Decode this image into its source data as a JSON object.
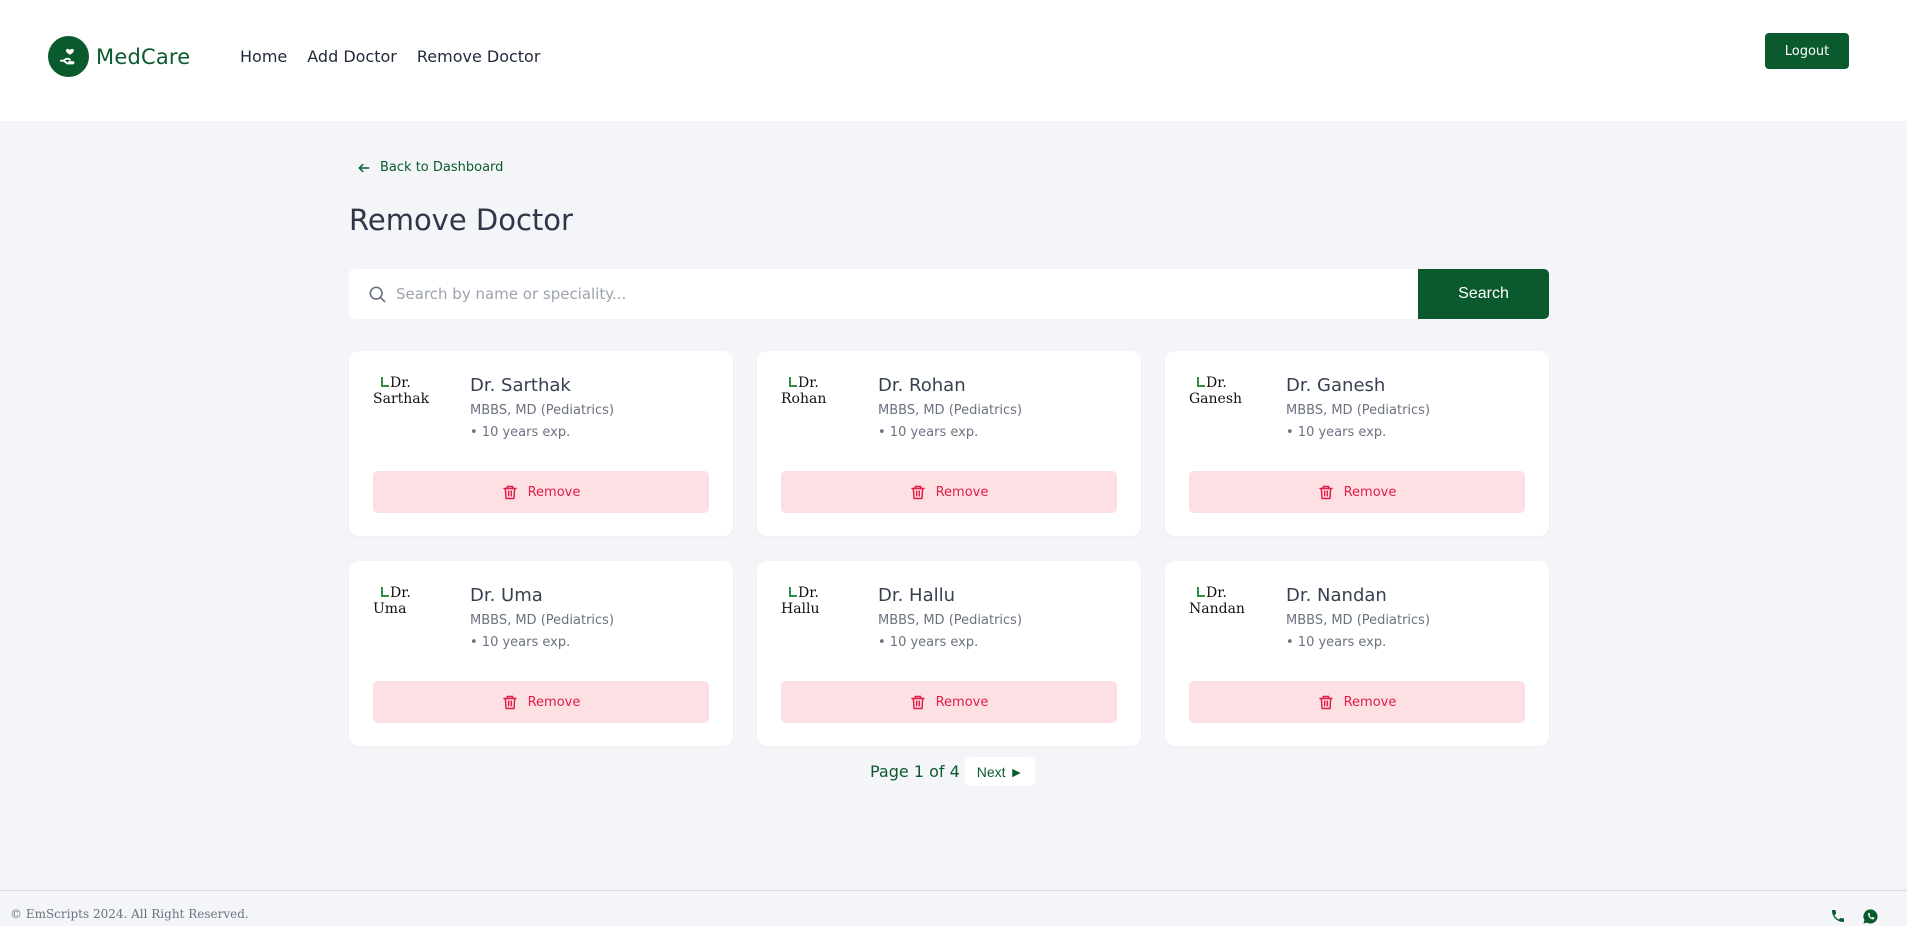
{
  "header": {
    "brand": "MedCare",
    "nav": [
      "Home",
      "Add Doctor",
      "Remove Doctor"
    ],
    "logout": "Logout"
  },
  "page": {
    "back_label": "Back to Dashboard",
    "title": "Remove Doctor"
  },
  "search": {
    "placeholder": "Search by name or speciality...",
    "value": "",
    "button": "Search"
  },
  "doctors": [
    {
      "alt_line1": "Dr.",
      "alt_line2": "Sarthak",
      "name": "Dr. Sarthak",
      "spec": "MBBS, MD (Pediatrics)",
      "exp": "• 10 years exp.",
      "remove": "Remove"
    },
    {
      "alt_line1": "Dr.",
      "alt_line2": "Rohan",
      "name": "Dr. Rohan",
      "spec": "MBBS, MD (Pediatrics)",
      "exp": "• 10 years exp.",
      "remove": "Remove"
    },
    {
      "alt_line1": "Dr.",
      "alt_line2": "Ganesh",
      "name": "Dr. Ganesh",
      "spec": "MBBS, MD (Pediatrics)",
      "exp": "• 10 years exp.",
      "remove": "Remove"
    },
    {
      "alt_line1": "Dr. Uma",
      "alt_line2": "",
      "name": "Dr. Uma",
      "spec": "MBBS, MD (Pediatrics)",
      "exp": "• 10 years exp.",
      "remove": "Remove"
    },
    {
      "alt_line1": "Dr. Hallu",
      "alt_line2": "",
      "name": "Dr. Hallu",
      "spec": "MBBS, MD (Pediatrics)",
      "exp": "• 10 years exp.",
      "remove": "Remove"
    },
    {
      "alt_line1": "Dr.",
      "alt_line2": "Nandan",
      "name": "Dr. Nandan",
      "spec": "MBBS, MD (Pediatrics)",
      "exp": "• 10 years exp.",
      "remove": "Remove"
    }
  ],
  "pagination": {
    "text": "Page 1 of 4",
    "next": "Next ►"
  },
  "footer": {
    "copyright": "© EmScripts 2024. All Right Reserved."
  },
  "colors": {
    "brand": "#0b5a2e",
    "remove_bg": "#fde0e3",
    "remove_text": "#e11d48",
    "page_bg": "#f4f5f8"
  },
  "icons": {
    "brand": "heart-hand-icon",
    "back": "arrow-left-icon",
    "search": "search-icon",
    "remove": "trash-icon",
    "footer": [
      "phone-icon",
      "whatsapp-icon"
    ]
  }
}
